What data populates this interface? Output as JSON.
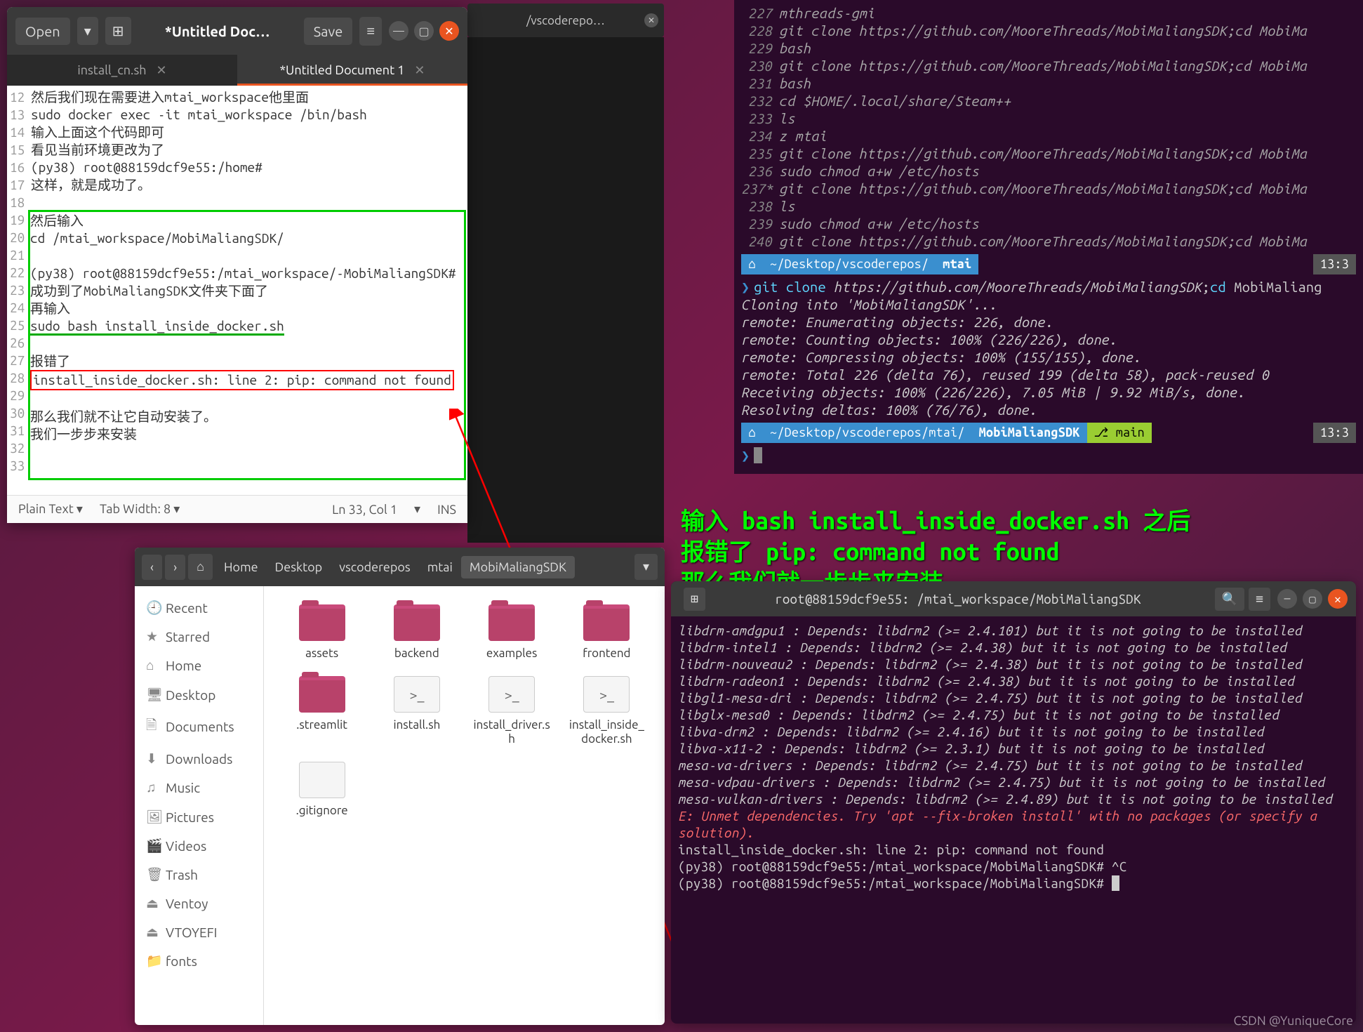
{
  "gedit": {
    "open_label": "Open",
    "title": "*Untitled Doc…",
    "save_label": "Save",
    "tabs": [
      {
        "label": "install_cn.sh",
        "active": false
      },
      {
        "label": "*Untitled Document 1",
        "active": true
      }
    ],
    "lines": [
      {
        "n": 12,
        "t": "然后我们现在需要进入mtai_workspace他里面"
      },
      {
        "n": 13,
        "t": "sudo docker exec -it mtai_workspace /bin/bash"
      },
      {
        "n": 14,
        "t": "输入上面这个代码即可"
      },
      {
        "n": 15,
        "t": "看见当前环境更改为了"
      },
      {
        "n": 16,
        "t": "(py38) root@88159dcf9e55:/home#"
      },
      {
        "n": 17,
        "t": "这样，就是成功了。"
      },
      {
        "n": 18,
        "t": ""
      },
      {
        "n": 19,
        "t": "然后输入",
        "group": "g"
      },
      {
        "n": 20,
        "t": "cd /mtai_workspace/MobiMaliangSDK/",
        "group": "g"
      },
      {
        "n": 21,
        "t": "",
        "group": "g"
      },
      {
        "n": 22,
        "t": "(py38) root@88159dcf9e55:/mtai_workspace/-MobiMaliangSDK#",
        "group": "g"
      },
      {
        "n": 23,
        "t": "成功到了MobiMaliangSDK文件夹下面了",
        "group": "g"
      },
      {
        "n": 24,
        "t": "再输入",
        "group": "g"
      },
      {
        "n": 25,
        "t": "sudo bash install_inside_docker.sh",
        "group": "g",
        "u": true
      },
      {
        "n": 26,
        "t": "",
        "group": "g"
      },
      {
        "n": 27,
        "t": "报错了",
        "group": "g"
      },
      {
        "n": 28,
        "t": "install_inside_docker.sh: line 2: pip: command not found",
        "group": "g",
        "r": true
      },
      {
        "n": 29,
        "t": "",
        "group": "g"
      },
      {
        "n": 30,
        "t": "那么我们就不让它自动安装了。",
        "group": "g"
      },
      {
        "n": 31,
        "t": "我们一步步来安装",
        "group": "g"
      },
      {
        "n": 32,
        "t": "",
        "group": "g"
      },
      {
        "n": 33,
        "t": "",
        "group": "g"
      }
    ],
    "status": {
      "lang": "Plain Text",
      "tab": "Tab Width: 8",
      "pos": "Ln 33, Col 1",
      "ins": "INS"
    }
  },
  "vscode_fragment": {
    "title": "/vscoderepo…"
  },
  "term1": {
    "history": [
      {
        "n": "227",
        "t": "mthreads-gmi"
      },
      {
        "n": "228",
        "t": "git clone https://github.com/MooreThreads/MobiMaliangSDK;cd MobiMa"
      },
      {
        "n": "229",
        "t": "bash"
      },
      {
        "n": "230",
        "t": "git clone https://github.com/MooreThreads/MobiMaliangSDK;cd MobiMa"
      },
      {
        "n": "231",
        "t": "bash"
      },
      {
        "n": "232",
        "t": "cd $HOME/.local/share/Steam++"
      },
      {
        "n": "233",
        "t": "ls"
      },
      {
        "n": "234",
        "t": "z mtai"
      },
      {
        "n": "235",
        "t": "git clone https://github.com/MooreThreads/MobiMaliangSDK;cd MobiMa"
      },
      {
        "n": "236",
        "t": "sudo chmod a+w /etc/hosts"
      },
      {
        "n": "237*",
        "t": "git clone https://github.com/MooreThreads/MobiMaliangSDK;cd MobiMa"
      },
      {
        "n": "238",
        "t": "ls"
      },
      {
        "n": "239",
        "t": "sudo chmod a+w /etc/hosts"
      },
      {
        "n": "240",
        "t": "git clone https://github.com/MooreThreads/MobiMaliangSDK;cd MobiMa"
      }
    ],
    "path1": {
      "segs": [
        "~/Desktop/vscoderepos/",
        "mtai"
      ],
      "time": "13:3"
    },
    "command1": "git clone https://github.com/MooreThreads/MobiMaliangSDK;cd MobiMaliang",
    "output": [
      "Cloning into 'MobiMaliangSDK'...",
      "remote: Enumerating objects: 226, done.",
      "remote: Counting objects: 100% (226/226), done.",
      "remote: Compressing objects: 100% (155/155), done.",
      "remote: Total 226 (delta 76), reused 199 (delta 58), pack-reused 0",
      "Receiving objects: 100% (226/226), 7.05 MiB | 9.92 MiB/s, done.",
      "Resolving deltas: 100% (76/76), done."
    ],
    "path2": {
      "segs": [
        "~/Desktop/vscoderepos/mtai/",
        "MobiMaliangSDK"
      ],
      "branch": "main",
      "time": "13:3"
    }
  },
  "overlay": {
    "l1": "输入 bash install_inside_docker.sh 之后",
    "l2": "报错了 pip: command not found",
    "l3": "那么我们就一步步来安装"
  },
  "nautilus": {
    "crumbs": [
      "Home",
      "Desktop",
      "vscoderepos",
      "mtai",
      "MobiMaliangSDK"
    ],
    "sidebar": [
      {
        "ic": "🕘",
        "label": "Recent"
      },
      {
        "ic": "★",
        "label": "Starred"
      },
      {
        "ic": "⌂",
        "label": "Home"
      },
      {
        "ic": "🖥",
        "label": "Desktop"
      },
      {
        "ic": "🗎",
        "label": "Documents"
      },
      {
        "ic": "⬇",
        "label": "Downloads"
      },
      {
        "ic": "♫",
        "label": "Music"
      },
      {
        "ic": "🖼",
        "label": "Pictures"
      },
      {
        "ic": "🎬",
        "label": "Videos"
      },
      {
        "ic": "🗑",
        "label": "Trash"
      },
      {
        "ic": "⏏",
        "label": "Ventoy"
      },
      {
        "ic": "⏏",
        "label": "VTOYEFI"
      },
      {
        "ic": "📁",
        "label": "fonts"
      }
    ],
    "files": [
      {
        "name": "assets",
        "type": "folder"
      },
      {
        "name": "backend",
        "type": "folder"
      },
      {
        "name": "examples",
        "type": "folder"
      },
      {
        "name": "frontend",
        "type": "folder"
      },
      {
        "name": ".streamlit",
        "type": "folder"
      },
      {
        "name": "install.sh",
        "type": "script"
      },
      {
        "name": "install_driver.sh",
        "type": "script"
      },
      {
        "name": "install_inside_docker.sh",
        "type": "script"
      },
      {
        "name": ".gitignore",
        "type": "text"
      }
    ]
  },
  "term2": {
    "title": "root@88159dcf9e55: /mtai_workspace/MobiMaliangSDK",
    "lines": [
      " libdrm-amdgpu1 : Depends: libdrm2 (>= 2.4.101) but it is not going to be installed",
      " libdrm-intel1 : Depends: libdrm2 (>= 2.4.38) but it is not going to be installed",
      " libdrm-nouveau2 : Depends: libdrm2 (>= 2.4.38) but it is not going to be installed",
      " libdrm-radeon1 : Depends: libdrm2 (>= 2.4.38) but it is not going to be installed",
      " libgl1-mesa-dri : Depends: libdrm2 (>= 2.4.75) but it is not going to be installed",
      " libglx-mesa0 : Depends: libdrm2 (>= 2.4.75) but it is not going to be installed",
      " libva-drm2 : Depends: libdrm2 (>= 2.4.16) but it is not going to be installed",
      " libva-x11-2 : Depends: libdrm2 (>= 2.3.1) but it is not going to be installed",
      " mesa-va-drivers : Depends: libdrm2 (>= 2.4.75) but it is not going to be installed",
      " mesa-vdpau-drivers : Depends: libdrm2 (>= 2.4.75) but it is not going to be installed",
      " mesa-vulkan-drivers : Depends: libdrm2 (>= 2.4.89) but it is not going to be installed"
    ],
    "err": "E: Unmet dependencies. Try 'apt --fix-broken install' with no packages (or specify a solution).",
    "script_err": "install_inside_docker.sh: line 2: pip: command not found",
    "prompt1": "(py38) root@88159dcf9e55:/mtai_workspace/MobiMaliangSDK# ^C",
    "prompt2": "(py38) root@88159dcf9e55:/mtai_workspace/MobiMaliangSDK# "
  },
  "watermark": "CSDN @YuniqueCore"
}
